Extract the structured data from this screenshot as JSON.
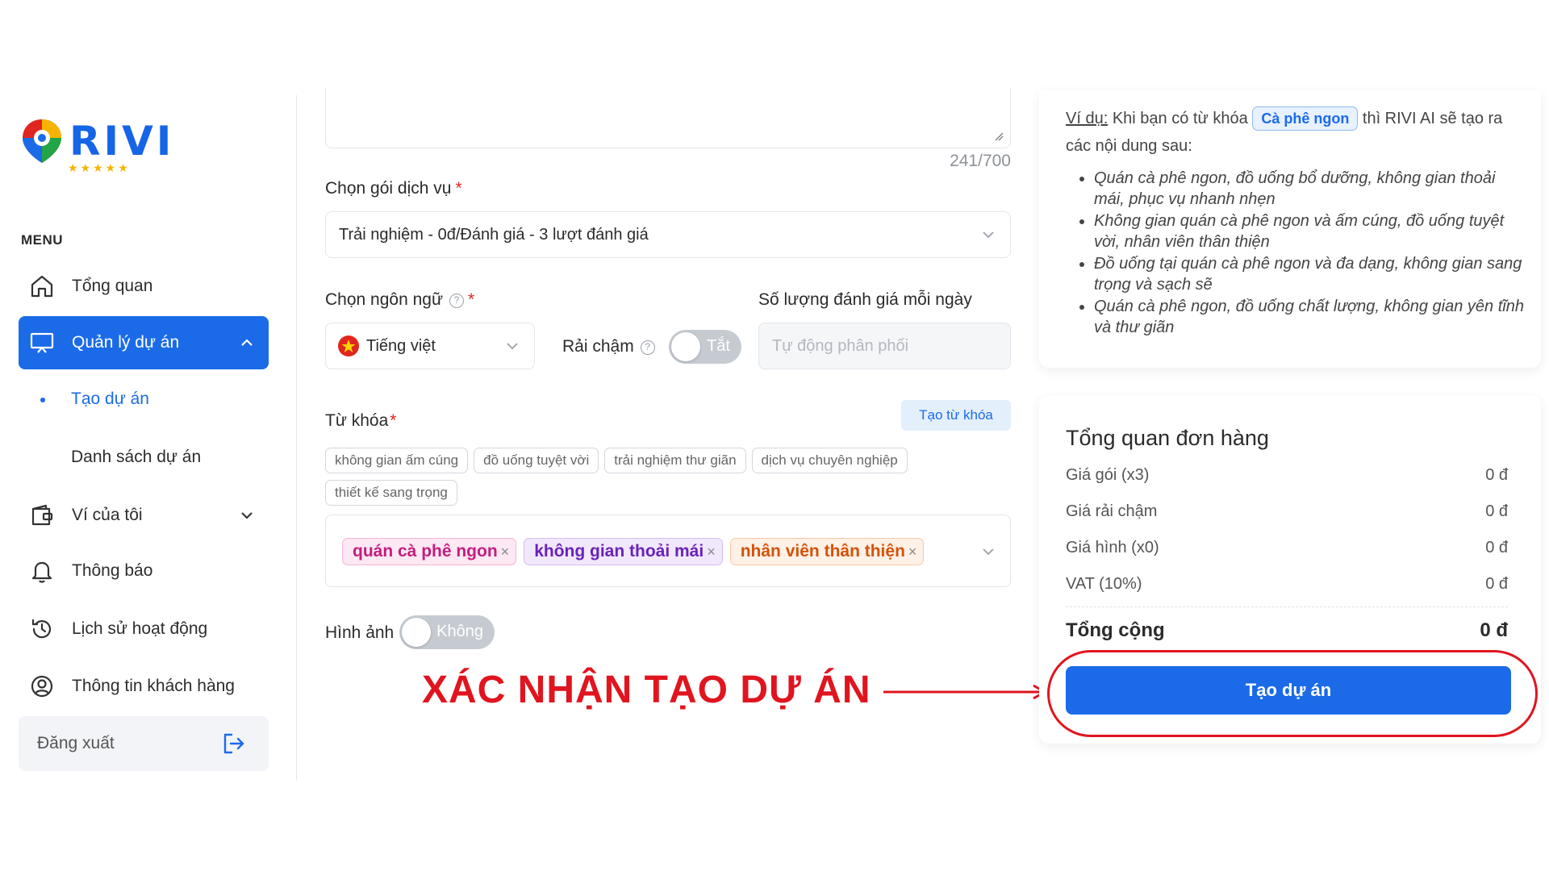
{
  "brand": {
    "name": "RIVI",
    "stars": "★★★★★"
  },
  "sidebar": {
    "menu_label": "MENU",
    "items": [
      {
        "label": "Tổng quan",
        "icon": "home-icon"
      },
      {
        "label": "Quản lý dự án",
        "icon": "monitor-icon",
        "active": true
      },
      {
        "label": "Ví của tôi",
        "icon": "wallet-icon"
      },
      {
        "label": "Thông báo",
        "icon": "bell-icon"
      },
      {
        "label": "Lịch sử hoạt động",
        "icon": "history-icon"
      },
      {
        "label": "Thông tin khách hàng",
        "icon": "user-circle-icon"
      }
    ],
    "sub_items": [
      {
        "label": "Tạo dự án",
        "current": true
      },
      {
        "label": "Danh sách dự án"
      }
    ],
    "logout_label": "Đăng xuất"
  },
  "form": {
    "char_counter": "241/700",
    "service_label": "Chọn gói dịch vụ",
    "service_value": "Trải nghiệm - 0đ/Đánh giá - 3 lượt đánh giá",
    "language_label": "Chọn ngôn ngữ",
    "language_value": "Tiếng việt",
    "drip_label": "Rải chậm",
    "drip_toggle": "Tắt",
    "daily_label": "Số lượng đánh giá mỗi ngày",
    "daily_placeholder": "Tự động phân phối",
    "keyword_label": "Từ khóa",
    "create_keyword_button": "Tạo từ khóa",
    "suggestions": [
      "không gian ấm cúng",
      "đồ uống tuyệt vời",
      "trải nghiệm thư giãn",
      "dịch vụ chuyên nghiệp",
      "thiết kế sang trọng"
    ],
    "selected_tags": [
      "quán cà phê ngon",
      "không gian thoải mái",
      "nhân viên thân thiện"
    ],
    "image_label": "Hình ảnh",
    "image_toggle": "Không",
    "required_mark": "*",
    "help_mark": "?",
    "tag_remove": "×"
  },
  "example": {
    "prefix": "Ví dụ:",
    "text_before": " Khi bạn có từ khóa ",
    "keyword": "Cà phê ngon",
    "text_after": " thì RIVI AI sẽ tạo ra các nội dung sau:",
    "items": [
      "Quán cà phê ngon, đồ uống bổ dưỡng, không gian thoải mái, phục vụ nhanh nhẹn",
      "Không gian quán cà phê ngon và ấm cúng, đồ uống tuyệt vời, nhân viên thân thiện",
      "Đồ uống tại quán cà phê ngon và đa dạng, không gian sang trọng và sạch sẽ",
      "Quán cà phê ngon, đồ uống chất lượng, không gian yên tĩnh và thư giãn"
    ]
  },
  "order": {
    "title": "Tổng quan đơn hàng",
    "rows": [
      {
        "label": "Giá gói (x3)",
        "value": "0 đ"
      },
      {
        "label": "Giá rải chậm",
        "value": "0 đ"
      },
      {
        "label": "Giá hình (x0)",
        "value": "0 đ"
      },
      {
        "label": "VAT (10%)",
        "value": "0 đ"
      }
    ],
    "total_label": "Tổng cộng",
    "total_value": "0 đ",
    "submit_label": "Tạo dự án"
  },
  "annotation": {
    "text": "XÁC NHẬN TẠO DỰ ÁN",
    "color": "#e0151f"
  },
  "colors": {
    "primary": "#1b6be8",
    "accent_red": "#e0151f",
    "star": "#f5b400"
  }
}
